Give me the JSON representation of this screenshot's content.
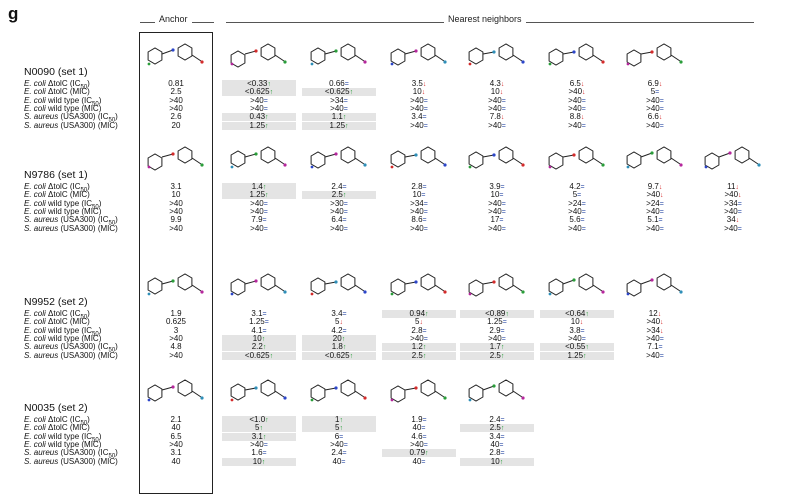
{
  "panel_letter": "g",
  "headers": {
    "anchor": "Anchor",
    "neighbors": "Nearest neighbors"
  },
  "row_labels": [
    [
      "E. coli",
      " ΔtolC (IC",
      "50",
      ")"
    ],
    [
      "E. coli",
      " ΔtolC (MIC)",
      "",
      ""
    ],
    [
      "E. coli",
      " wild type (IC",
      "50",
      ")"
    ],
    [
      "E. coli",
      " wild type (MIC)",
      "",
      ""
    ],
    [
      "S. aureus",
      " (USA300) (IC",
      "50",
      ")"
    ],
    [
      "S. aureus",
      " (USA300) (MIC)",
      "",
      ""
    ]
  ],
  "arrow_glyphs": {
    "up": "↑",
    "down": "↓",
    "eq": "="
  },
  "groups": [
    {
      "name": "N0090 (set 1)",
      "anchor": [
        "0.81",
        "2.5",
        ">40",
        ">40",
        "2.6",
        "20"
      ],
      "neighbors": [
        [
          [
            "<0.33",
            "up",
            1
          ],
          [
            "<0.625",
            "up",
            1
          ],
          [
            ">40",
            "eq",
            0
          ],
          [
            ">40",
            "eq",
            0
          ],
          [
            "0.43",
            "up",
            1
          ],
          [
            "1.25",
            "up",
            1
          ]
        ],
        [
          [
            "0.66",
            "eq",
            0
          ],
          [
            "<0.625",
            "up",
            1
          ],
          [
            ">34",
            "eq",
            0
          ],
          [
            ">40",
            "eq",
            0
          ],
          [
            "1.1",
            "up",
            1
          ],
          [
            "1.25",
            "up",
            1
          ]
        ],
        [
          [
            "3.5",
            "down",
            0
          ],
          [
            "10",
            "down",
            0
          ],
          [
            ">40",
            "eq",
            0
          ],
          [
            ">40",
            "eq",
            0
          ],
          [
            "3.4",
            "eq",
            0
          ],
          [
            ">40",
            "eq",
            0
          ]
        ],
        [
          [
            "4.3",
            "down",
            0
          ],
          [
            "10",
            "down",
            0
          ],
          [
            ">40",
            "eq",
            0
          ],
          [
            ">40",
            "eq",
            0
          ],
          [
            "7.8",
            "down",
            0
          ],
          [
            ">40",
            "eq",
            0
          ]
        ],
        [
          [
            "6.5",
            "down",
            0
          ],
          [
            ">40",
            "down",
            0
          ],
          [
            ">40",
            "eq",
            0
          ],
          [
            ">40",
            "eq",
            0
          ],
          [
            "8.8",
            "down",
            0
          ],
          [
            ">40",
            "eq",
            0
          ]
        ],
        [
          [
            "6.9",
            "down",
            0
          ],
          [
            "5",
            "eq",
            0
          ],
          [
            ">40",
            "eq",
            0
          ],
          [
            ">40",
            "eq",
            0
          ],
          [
            "6.6",
            "down",
            0
          ],
          [
            ">40",
            "eq",
            0
          ]
        ]
      ]
    },
    {
      "name": "N9786 (set 1)",
      "anchor": [
        "3.1",
        "10",
        ">40",
        ">40",
        "9.9",
        ">40"
      ],
      "neighbors": [
        [
          [
            "1.4",
            "up",
            1
          ],
          [
            "1.25",
            "up",
            1
          ],
          [
            ">40",
            "eq",
            0
          ],
          [
            ">40",
            "eq",
            0
          ],
          [
            "7.9",
            "eq",
            0
          ],
          [
            ">40",
            "eq",
            0
          ]
        ],
        [
          [
            "2.4",
            "eq",
            0
          ],
          [
            "2.5",
            "up",
            1
          ],
          [
            ">30",
            "eq",
            0
          ],
          [
            ">40",
            "eq",
            0
          ],
          [
            "6.4",
            "eq",
            0
          ],
          [
            ">40",
            "eq",
            0
          ]
        ],
        [
          [
            "2.8",
            "eq",
            0
          ],
          [
            "10",
            "eq",
            0
          ],
          [
            ">34",
            "eq",
            0
          ],
          [
            ">40",
            "eq",
            0
          ],
          [
            "8.6",
            "eq",
            0
          ],
          [
            ">40",
            "eq",
            0
          ]
        ],
        [
          [
            "3.9",
            "eq",
            0
          ],
          [
            "10",
            "eq",
            0
          ],
          [
            ">40",
            "eq",
            0
          ],
          [
            ">40",
            "eq",
            0
          ],
          [
            "17",
            "eq",
            0
          ],
          [
            ">40",
            "eq",
            0
          ]
        ],
        [
          [
            "4.2",
            "eq",
            0
          ],
          [
            "5",
            "eq",
            0
          ],
          [
            ">24",
            "eq",
            0
          ],
          [
            ">40",
            "eq",
            0
          ],
          [
            "5.6",
            "eq",
            0
          ],
          [
            ">40",
            "eq",
            0
          ]
        ],
        [
          [
            "9.7",
            "down",
            0
          ],
          [
            ">40",
            "down",
            0
          ],
          [
            ">24",
            "eq",
            0
          ],
          [
            ">40",
            "eq",
            0
          ],
          [
            "5.1",
            "eq",
            0
          ],
          [
            ">40",
            "eq",
            0
          ]
        ],
        [
          [
            "11",
            "down",
            0
          ],
          [
            ">40",
            "down",
            0
          ],
          [
            ">34",
            "eq",
            0
          ],
          [
            ">40",
            "eq",
            0
          ],
          [
            "34",
            "down",
            0
          ],
          [
            ">40",
            "eq",
            0
          ]
        ]
      ]
    },
    {
      "name": "N9952 (set 2)",
      "anchor": [
        "1.9",
        "0.625",
        "3",
        ">40",
        "4.8",
        ">40"
      ],
      "neighbors": [
        [
          [
            "3.1",
            "eq",
            0
          ],
          [
            "1.25",
            "eq",
            0
          ],
          [
            "4.1",
            "eq",
            0
          ],
          [
            "10",
            "up",
            1
          ],
          [
            "2.2",
            "up",
            1
          ],
          [
            "<0.625",
            "up",
            1
          ]
        ],
        [
          [
            "3.4",
            "eq",
            0
          ],
          [
            "5",
            "down",
            0
          ],
          [
            "4.2",
            "eq",
            0
          ],
          [
            "20",
            "up",
            1
          ],
          [
            "1.8",
            "up",
            1
          ],
          [
            "<0.625",
            "up",
            1
          ]
        ],
        [
          [
            "0.94",
            "up",
            1
          ],
          [
            "5",
            "down",
            0
          ],
          [
            "2.8",
            "eq",
            0
          ],
          [
            ">40",
            "eq",
            0
          ],
          [
            "1.2",
            "up",
            1
          ],
          [
            "2.5",
            "up",
            1
          ]
        ],
        [
          [
            "<0.89",
            "up",
            1
          ],
          [
            "1.25",
            "eq",
            0
          ],
          [
            "2.9",
            "eq",
            0
          ],
          [
            ">40",
            "eq",
            0
          ],
          [
            "1.7",
            "up",
            1
          ],
          [
            "2.5",
            "up",
            1
          ]
        ],
        [
          [
            "<0.64",
            "up",
            1
          ],
          [
            "10",
            "down",
            0
          ],
          [
            "3.8",
            "eq",
            0
          ],
          [
            ">40",
            "eq",
            0
          ],
          [
            "<0.55",
            "up",
            1
          ],
          [
            "1.25",
            "up",
            1
          ]
        ],
        [
          [
            "12",
            "down",
            0
          ],
          [
            ">40",
            "down",
            0
          ],
          [
            ">34",
            "down",
            0
          ],
          [
            ">40",
            "eq",
            0
          ],
          [
            "7.1",
            "eq",
            0
          ],
          [
            ">40",
            "eq",
            0
          ]
        ]
      ]
    },
    {
      "name": "N0035 (set 2)",
      "anchor": [
        "2.1",
        "40",
        "6.5",
        ">40",
        "3.1",
        "40"
      ],
      "neighbors": [
        [
          [
            "<1.0",
            "up",
            1
          ],
          [
            "5",
            "up",
            1
          ],
          [
            "3.1",
            "up",
            1
          ],
          [
            ">40",
            "eq",
            0
          ],
          [
            "1.6",
            "eq",
            0
          ],
          [
            "10",
            "up",
            1
          ]
        ],
        [
          [
            "1",
            "up",
            1
          ],
          [
            "5",
            "up",
            1
          ],
          [
            "6",
            "eq",
            0
          ],
          [
            ">40",
            "eq",
            0
          ],
          [
            "2.4",
            "eq",
            0
          ],
          [
            "40",
            "eq",
            0
          ]
        ],
        [
          [
            "1.9",
            "eq",
            0
          ],
          [
            "40",
            "eq",
            0
          ],
          [
            "4.6",
            "eq",
            0
          ],
          [
            ">40",
            "eq",
            0
          ],
          [
            "0.79",
            "up",
            1
          ],
          [
            "40",
            "eq",
            0
          ]
        ],
        [
          [
            "2.4",
            "eq",
            0
          ],
          [
            "2.5",
            "up",
            1
          ],
          [
            "3.4",
            "eq",
            0
          ],
          [
            "40",
            "eq",
            0
          ],
          [
            "2.8",
            "eq",
            0
          ],
          [
            "10",
            "up",
            1
          ]
        ]
      ]
    }
  ]
}
